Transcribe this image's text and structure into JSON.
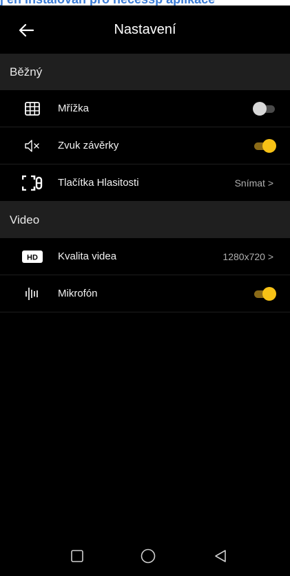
{
  "banner": {
    "text": "j en instalovan pro necessp aplikace"
  },
  "header": {
    "title": "Nastavení"
  },
  "sections": {
    "general": {
      "title": "Běžný",
      "grid": {
        "label": "Mřížka",
        "icon": "grid-icon",
        "enabled": false
      },
      "shutter_sound": {
        "label": "Zvuk závěrky",
        "icon": "speaker-muted-icon",
        "enabled": true
      },
      "volume_buttons": {
        "label": "Tlačítka Hlasitosti",
        "icon": "volume-buttons-icon",
        "value": "Snímat >"
      }
    },
    "video": {
      "title": "Video",
      "quality": {
        "label": "Kvalita videa",
        "icon": "hd-icon",
        "value": "1280x720 >"
      },
      "microphone": {
        "label": "Mikrofón",
        "icon": "microphone-bars-icon",
        "enabled": true
      }
    }
  },
  "colors": {
    "background": "#000000",
    "section_background": "#1f1f1f",
    "toggle_on": "#f7c216",
    "toggle_off": "#d8d8d8"
  }
}
